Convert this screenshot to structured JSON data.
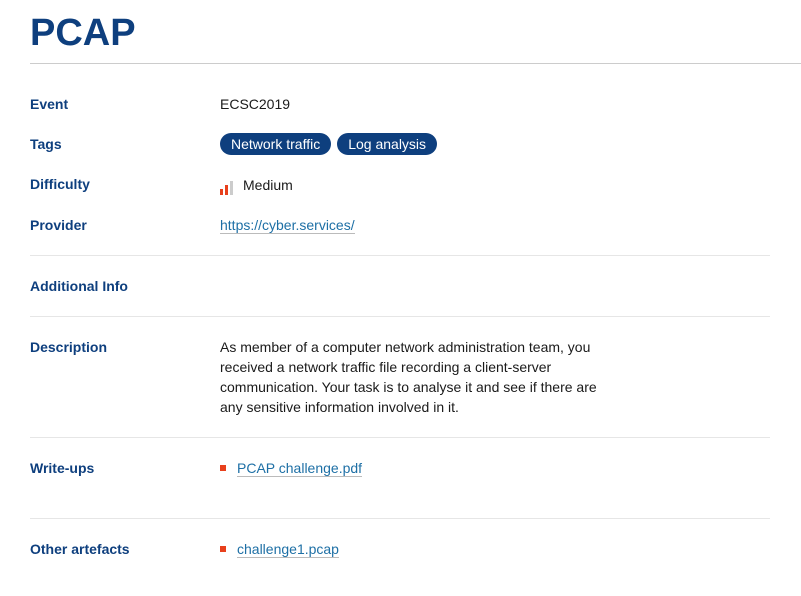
{
  "title": "PCAP",
  "labels": {
    "event": "Event",
    "tags": "Tags",
    "difficulty": "Difficulty",
    "provider": "Provider",
    "additional": "Additional Info",
    "description": "Description",
    "writeups": "Write-ups",
    "artefacts": "Other artefacts"
  },
  "event": "ECSC2019",
  "tags": [
    "Network traffic",
    "Log analysis"
  ],
  "difficulty": {
    "label": "Medium",
    "level": 2,
    "max": 3
  },
  "provider": "https://cyber.services/",
  "description": "As member of a computer network administration team, you received a network traffic file recording a client-server communication. Your task is to analyse it and see if there are any sensitive information involved in it.",
  "writeups": [
    "PCAP challenge.pdf"
  ],
  "artefacts": [
    "challenge1.pcap"
  ],
  "colors": {
    "primary": "#0e3f7e",
    "accent": "#e8401c",
    "link": "#1d6fa5"
  }
}
